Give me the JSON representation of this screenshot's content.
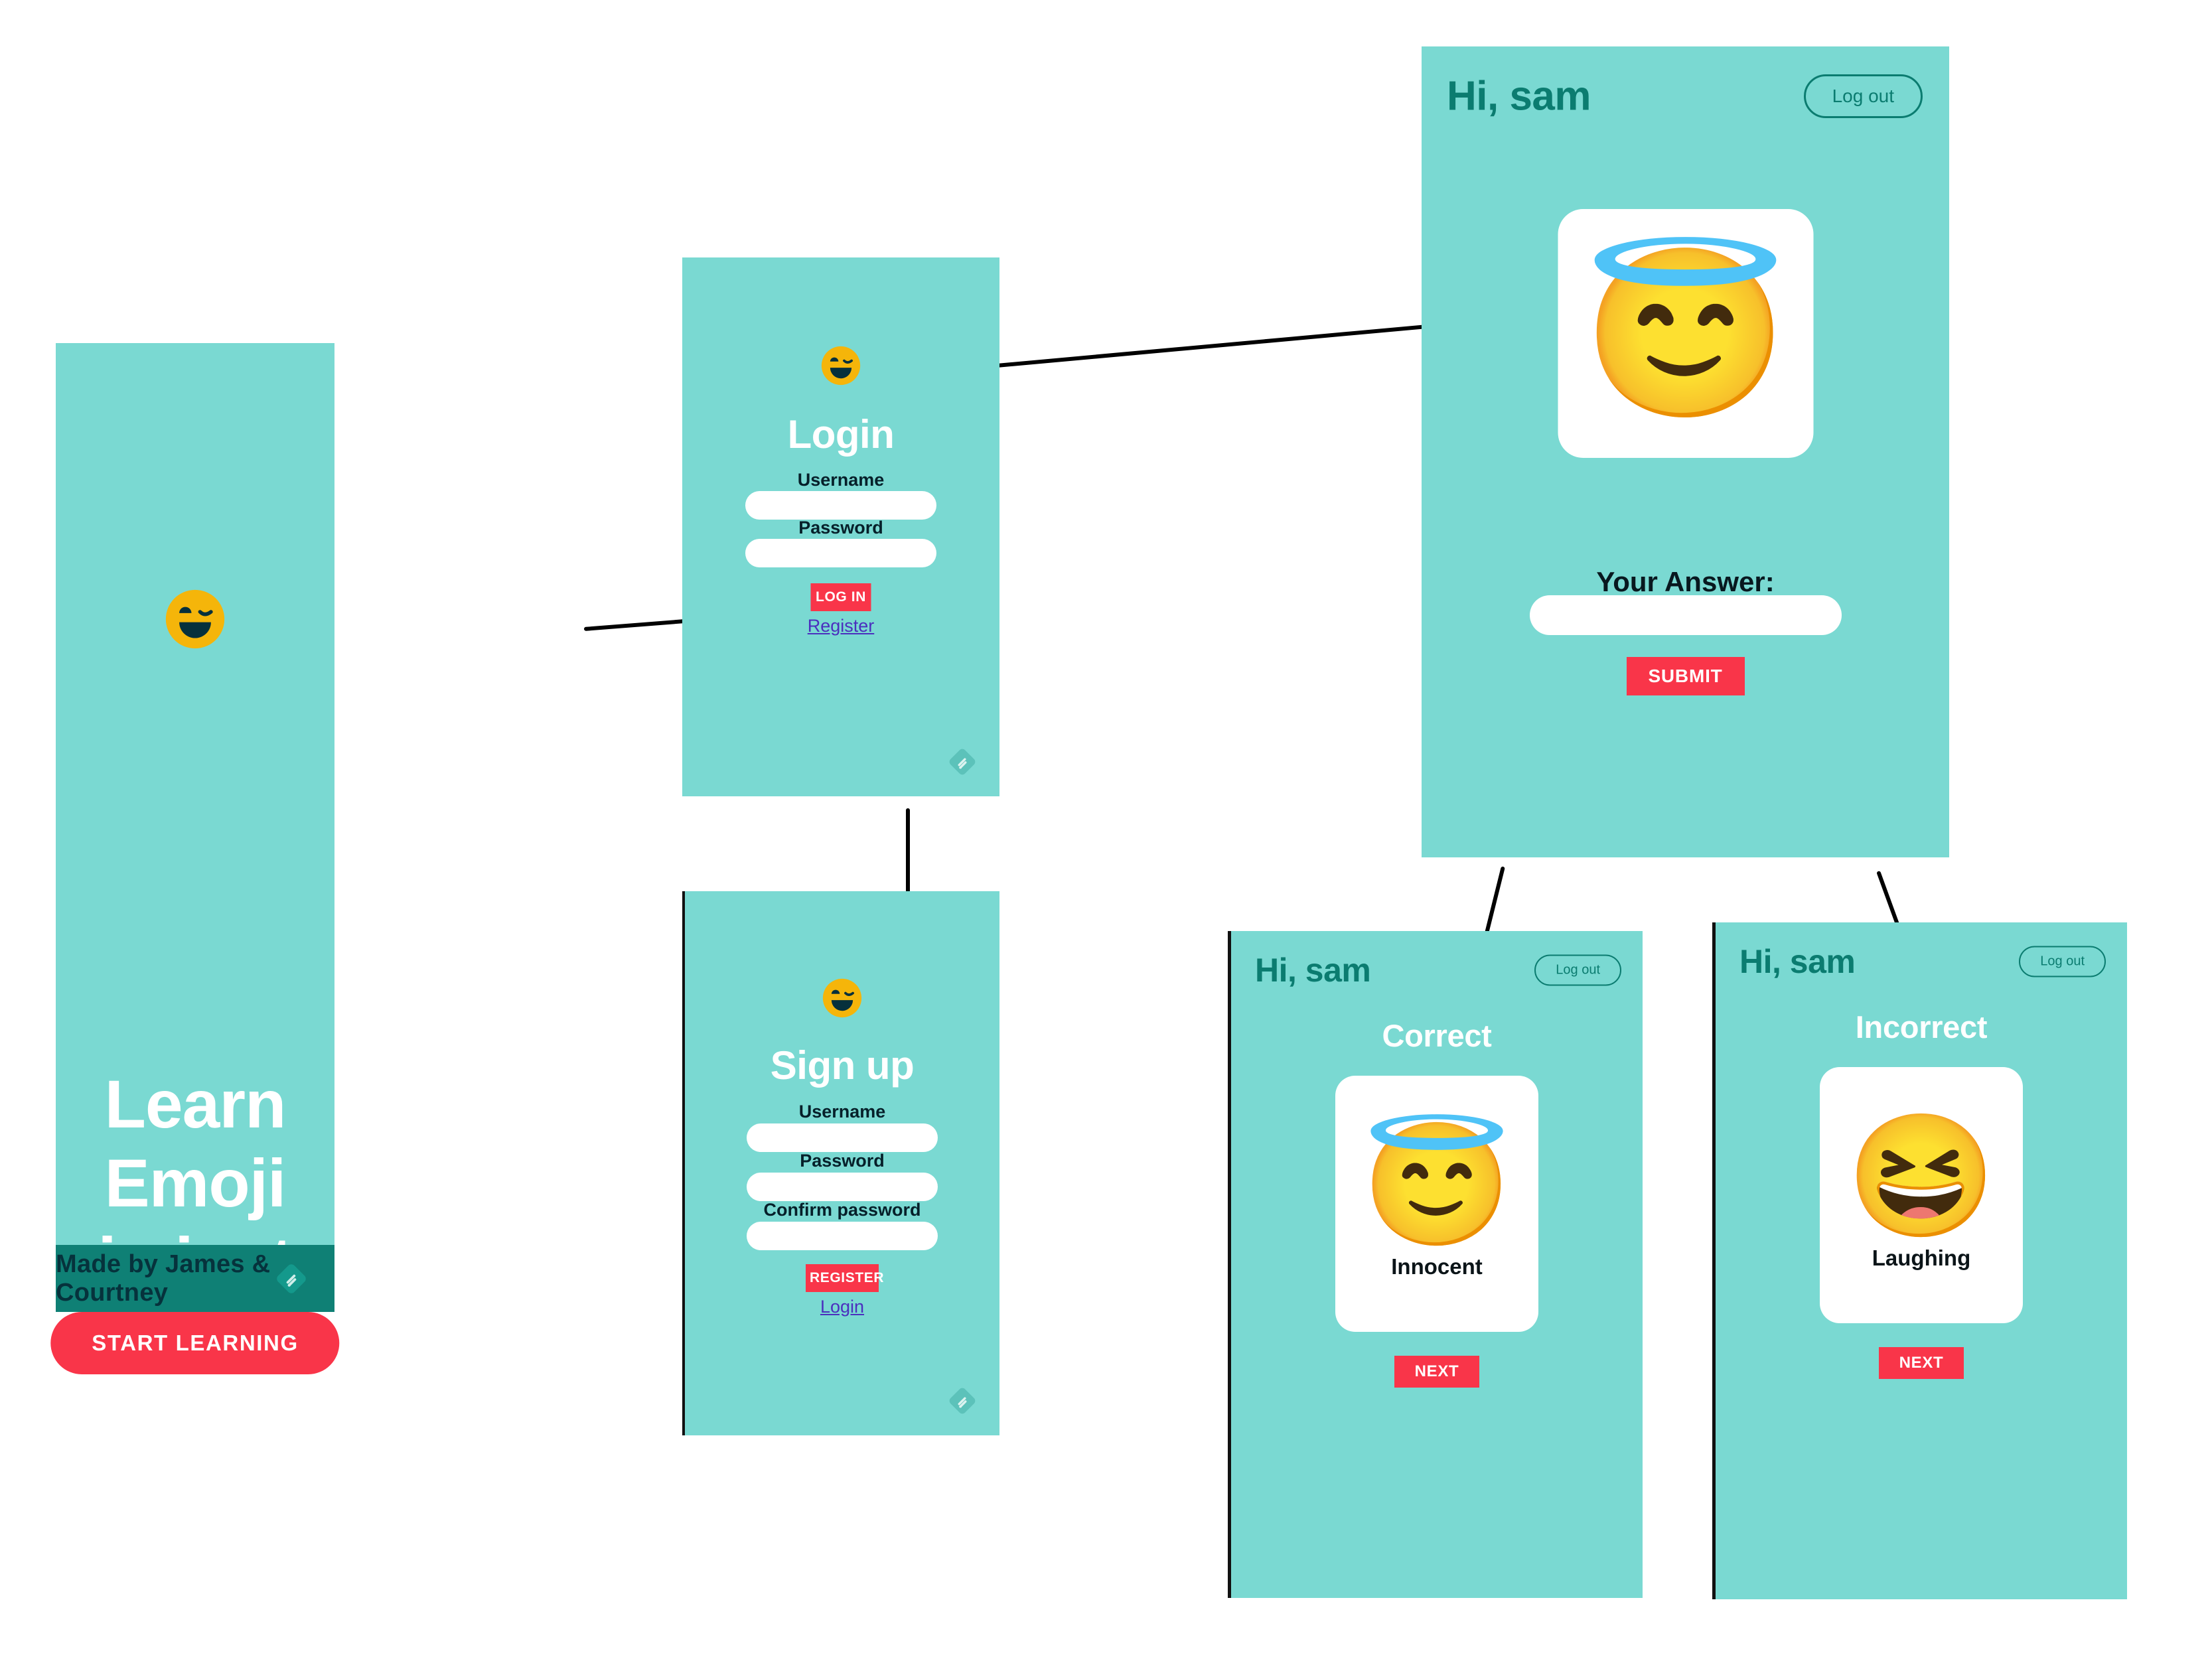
{
  "canvas": {
    "background": "#ffffff",
    "panel_color": "#7ad9d2",
    "accent_red": "#f93549",
    "deep_teal": "#0f8075",
    "header_teal": "#0b7c70",
    "link_purple": "#4b2fbe"
  },
  "hero": {
    "logo_icon": "winking-smiley-icon",
    "title": "Learn Emoji in just a few minutes a day",
    "cta_label": "START LEARNING",
    "footer_credit": "Made by James & Courtney",
    "footer_watermark_icon": "feedly-diamond-icon"
  },
  "login": {
    "logo_icon": "winking-smiley-icon",
    "heading": "Login",
    "fields": [
      {
        "label": "Username",
        "value": "",
        "placeholder": ""
      },
      {
        "label": "Password",
        "value": "",
        "placeholder": ""
      }
    ],
    "submit_label": "LOG IN",
    "alt_link_label": "Register",
    "watermark_icon": "feedly-diamond-icon"
  },
  "signup": {
    "logo_icon": "winking-smiley-icon",
    "heading": "Sign up",
    "fields": [
      {
        "label": "Username",
        "value": "",
        "placeholder": ""
      },
      {
        "label": "Password",
        "value": "",
        "placeholder": ""
      },
      {
        "label": "Confirm password",
        "value": "",
        "placeholder": ""
      }
    ],
    "submit_label": "REGISTER",
    "alt_link_label": "Login",
    "watermark_icon": "feedly-diamond-icon"
  },
  "quiz": {
    "greeting": "Hi, sam",
    "logout_label": "Log out",
    "card_emoji": "😇",
    "card_emoji_name": "smiling-face-with-halo-emoji",
    "answer_label": "Your Answer:",
    "answer_value": "",
    "answer_placeholder": "",
    "submit_label": "SUBMIT"
  },
  "correct": {
    "greeting": "Hi, sam",
    "logout_label": "Log out",
    "verdict": "Correct",
    "card_emoji": "😇",
    "card_emoji_name": "smiling-face-with-halo-emoji",
    "card_caption": "Innocent",
    "next_label": "NEXT"
  },
  "incorrect": {
    "greeting": "Hi, sam",
    "logout_label": "Log out",
    "verdict": "Incorrect",
    "card_emoji": "😆",
    "card_emoji_name": "grinning-squinting-face-emoji",
    "card_caption": "Laughing",
    "next_label": "NEXT"
  }
}
